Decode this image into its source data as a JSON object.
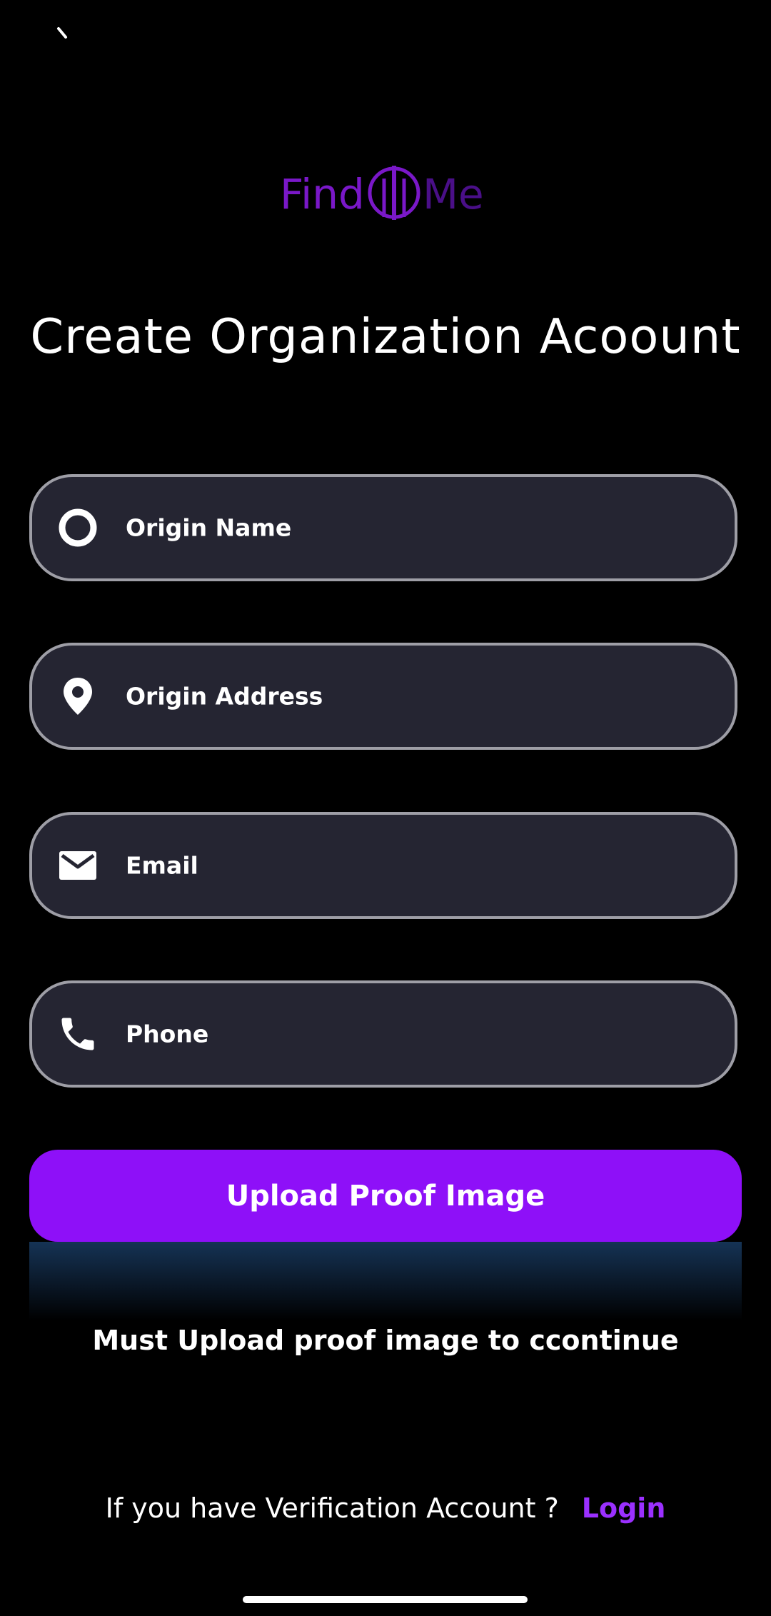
{
  "header": {
    "back_icon": "back-arrow-icon",
    "logo_text": "FindMe",
    "title": "Create Organization Acoount"
  },
  "form": {
    "fields": [
      {
        "label": "Origin Name",
        "icon": "ring-icon"
      },
      {
        "label": "Origin Address",
        "icon": "location-pin-icon"
      },
      {
        "label": "Email",
        "icon": "envelope-icon"
      },
      {
        "label": "Phone",
        "icon": "phone-icon"
      }
    ]
  },
  "upload": {
    "button_label": "Upload Proof Image",
    "notice": "Must Upload proof image to ccontinue"
  },
  "footer": {
    "question": "If you have Verification Account ?",
    "login_label": "Login"
  },
  "colors": {
    "background": "#000000",
    "field_bg": "#252532",
    "field_border": "#9e9ea6",
    "accent": "#8e10f8",
    "login": "#9b30ff",
    "logo": "#7a18c8"
  }
}
